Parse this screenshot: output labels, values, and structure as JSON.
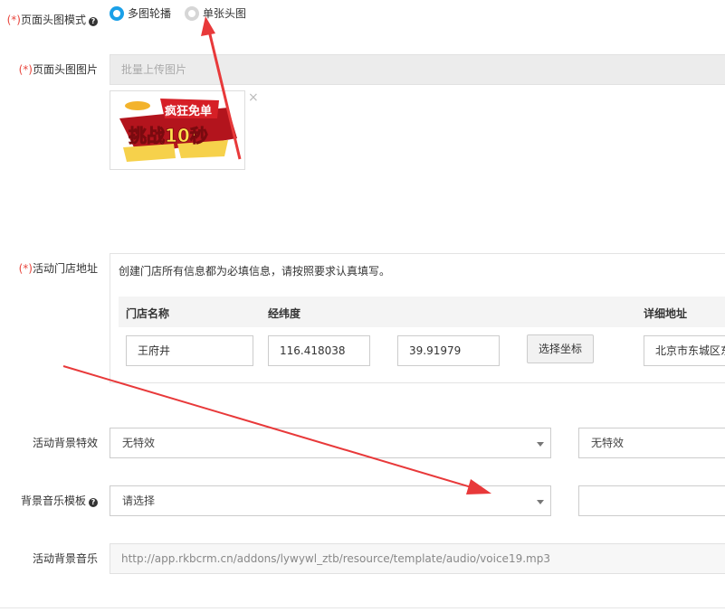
{
  "fields": {
    "header_mode": {
      "required_mark": "(*)",
      "label": "页面头图模式",
      "options": [
        {
          "label": "多图轮播",
          "selected": true
        },
        {
          "label": "单张头图",
          "selected": false
        }
      ]
    },
    "header_image": {
      "required_mark": "(*)",
      "label": "页面头图图片",
      "upload_label": "批量上传图片",
      "thumbnail": {
        "title_top": "疯狂免单",
        "title_main": "挑战10秒",
        "close": "×"
      }
    },
    "store_address": {
      "required_mark": "(*)",
      "label": "活动门店地址",
      "note": "创建门店所有信息都为必填信息，请按照要求认真填写。",
      "columns": [
        "门店名称",
        "经纬度",
        "详细地址"
      ],
      "row": {
        "name": "王府井",
        "longitude": "116.418038",
        "latitude": "39.91979",
        "pick_button": "选择坐标",
        "address": "北京市东城区东"
      }
    },
    "bg_effect": {
      "label": "活动背景特效",
      "value": "无特效",
      "second_value": "无特效"
    },
    "bg_music_template": {
      "label": "背景音乐模板",
      "value": "请选择",
      "second_value": ""
    },
    "bg_music": {
      "label": "活动背景音乐",
      "value": "http://app.rkbcrm.cn/addons/lywywl_ztb/resource/template/audio/voice19.mp3"
    }
  },
  "colors": {
    "accent": "#1aa0e8",
    "required": "#e8453c",
    "annotation_arrow": "#e8393a"
  },
  "icons": {
    "help": "question-circle-icon",
    "dropdown": "caret-down-icon",
    "remove": "close-icon"
  }
}
